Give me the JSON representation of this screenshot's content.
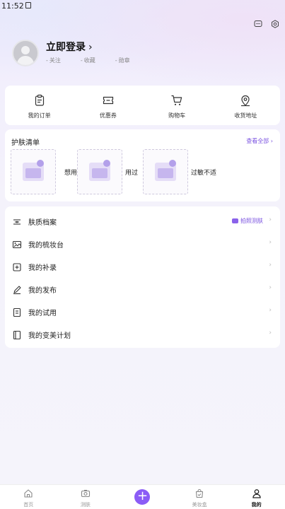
{
  "status": {
    "time": "11:52"
  },
  "profile": {
    "login_label": "立即登录",
    "chevron": "›",
    "stats": [
      {
        "label": "关注"
      },
      {
        "label": "收藏"
      },
      {
        "label": "勋章"
      }
    ]
  },
  "top_icons": [
    "message-icon",
    "settings-icon"
  ],
  "quick": [
    {
      "label": "我的订单",
      "icon": "order-icon"
    },
    {
      "label": "优惠券",
      "icon": "coupon-icon"
    },
    {
      "label": "购物车",
      "icon": "cart-icon"
    },
    {
      "label": "收货地址",
      "icon": "location-icon"
    }
  ],
  "skincare": {
    "title": "护肤清单",
    "view_all": "查看全部 ›",
    "items": [
      {
        "label": "想用"
      },
      {
        "label": "用过"
      },
      {
        "label": "过敏不适"
      }
    ]
  },
  "menu": [
    {
      "label": "肤质档案",
      "icon": "skin-profile-icon",
      "extra": "拍照测肤"
    },
    {
      "label": "我的梳妆台",
      "icon": "dresser-icon"
    },
    {
      "label": "我的补录",
      "icon": "add-record-icon"
    },
    {
      "label": "我的发布",
      "icon": "edit-icon"
    },
    {
      "label": "我的试用",
      "icon": "trial-icon"
    },
    {
      "label": "我的变美计划",
      "icon": "plan-icon"
    }
  ],
  "menu_arrow": "›",
  "nav": [
    {
      "label": "首页",
      "icon": "home-icon"
    },
    {
      "label": "测肤",
      "icon": "camera-icon"
    },
    {
      "label": "",
      "icon": "plus-icon"
    },
    {
      "label": "美妆盒",
      "icon": "bag-icon"
    },
    {
      "label": "我的",
      "icon": "profile-icon"
    }
  ],
  "colors": {
    "accent": "#8b5cf6",
    "link": "#7a52e0"
  }
}
